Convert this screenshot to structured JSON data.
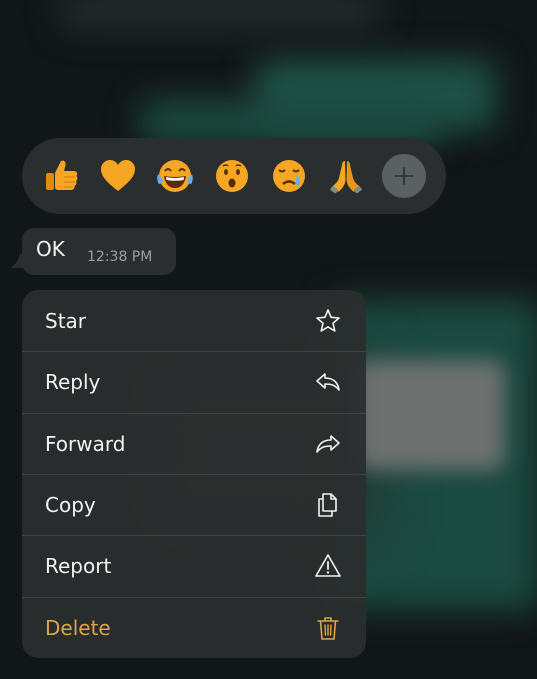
{
  "reactions": [
    {
      "icon": "thumbs-up-emoji"
    },
    {
      "icon": "heart-emoji"
    },
    {
      "icon": "tears-of-joy-emoji"
    },
    {
      "icon": "surprised-face-emoji"
    },
    {
      "icon": "crying-face-emoji"
    },
    {
      "icon": "folded-hands-emoji"
    }
  ],
  "reaction_more_icon": "plus-icon",
  "message": {
    "text": "OK",
    "time": "12:38 PM"
  },
  "menu": {
    "items": [
      {
        "label": "Star",
        "icon": "star-icon"
      },
      {
        "label": "Reply",
        "icon": "reply-icon"
      },
      {
        "label": "Forward",
        "icon": "forward-icon"
      },
      {
        "label": "Copy",
        "icon": "copy-icon"
      },
      {
        "label": "Report",
        "icon": "warning-icon"
      },
      {
        "label": "Delete",
        "icon": "trash-icon",
        "color": "#e0a344"
      }
    ]
  },
  "colors": {
    "background": "#111716",
    "surface": "#2b2e2e",
    "text": "#f2f2f2",
    "muted": "#9aa09f",
    "danger": "#e0a344",
    "emoji": "#f5a623"
  }
}
